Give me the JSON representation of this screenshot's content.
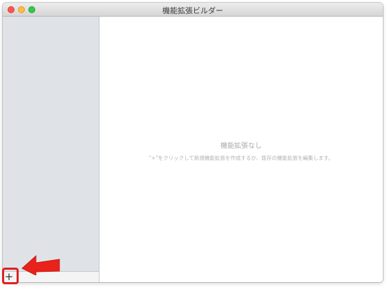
{
  "window": {
    "title": "機能拡張ビルダー"
  },
  "sidebar": {
    "add_button_label": "+"
  },
  "main": {
    "empty_title": "機能拡張なし",
    "empty_description": "\"+\"をクリックして新規機能拡張を作成するか、既存の機能拡張を編集します。"
  },
  "annotation": {
    "highlight_color": "#e02020",
    "arrow_color": "#e02020"
  }
}
